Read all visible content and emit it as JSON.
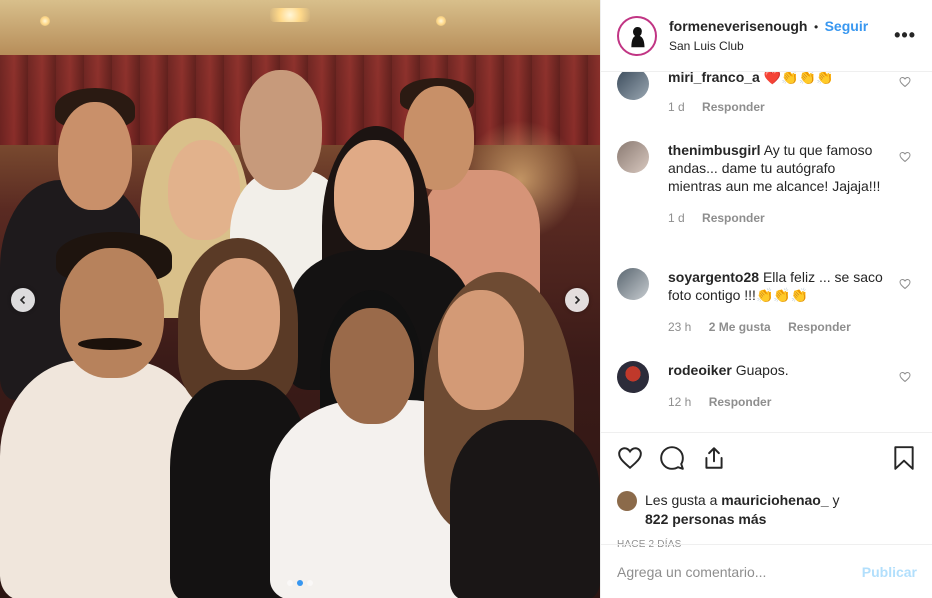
{
  "post": {
    "username": "formeneverisenough",
    "separator": "•",
    "follow_label": "Seguir",
    "location": "San Luis Club",
    "more_label": "•••"
  },
  "carousel": {
    "slide_count": 3,
    "active_index": 1
  },
  "comments": [
    {
      "user": "miri_franco_a",
      "text": "❤️👏👏👏",
      "time": "1 d",
      "likes": "",
      "reply_label": "Responder"
    },
    {
      "user": "thenimbusgirl",
      "text": "Ay tu que famoso andas... dame tu autógrafo mientras aun me alcance! Jajaja!!!",
      "time": "1 d",
      "likes": "",
      "reply_label": "Responder"
    },
    {
      "user": "soyargento28",
      "text": "Ella feliz ... se saco foto contigo !!!👏👏👏",
      "time": "23 h",
      "likes": "2 Me gusta",
      "reply_label": "Responder"
    },
    {
      "user": "rodeoiker",
      "text": "Guapos.",
      "time": "12 h",
      "likes": "",
      "reply_label": "Responder"
    }
  ],
  "likes": {
    "prefix": "Les gusta a",
    "user": "mauriciohenao_",
    "conj": "y",
    "others": "822 personas más"
  },
  "date": "HACE 2 DÍAS",
  "add_comment": {
    "placeholder": "Agrega un comentario...",
    "publish_label": "Publicar"
  },
  "icons": {
    "like": "heart-icon",
    "comment": "comment-icon",
    "share": "share-icon",
    "save": "bookmark-icon",
    "prev": "chevron-left-icon",
    "next": "chevron-right-icon"
  },
  "colors": {
    "link": "#3897f0",
    "muted": "#8e8e8e",
    "publish_disabled": "#b2dffc",
    "story_ring": "#c13584"
  }
}
